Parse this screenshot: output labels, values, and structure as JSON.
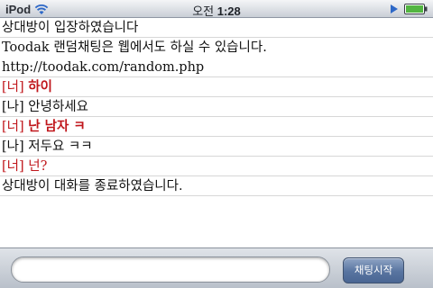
{
  "status_bar": {
    "carrier": "iPod",
    "period": "오전",
    "time": "1:28",
    "icons": [
      "wifi-icon",
      "play-icon",
      "battery-icon"
    ]
  },
  "chat": {
    "lines": [
      {
        "type": "system",
        "text": "상대방이 입장하였습니다"
      },
      {
        "type": "system",
        "text": "Toodak 랜덤채팅은 웹에서도 하실 수 있습니다."
      },
      {
        "type": "system",
        "text": "http://toodak.com/random.php"
      },
      {
        "type": "stranger",
        "prefix": "[너]",
        "text": "하이"
      },
      {
        "type": "me",
        "prefix": "[나]",
        "text": "안녕하세요"
      },
      {
        "type": "stranger",
        "prefix": "[너]",
        "text": "난 남자 ㅋ"
      },
      {
        "type": "me",
        "prefix": "[나]",
        "text": "저두요 ㅋㅋ"
      },
      {
        "type": "stranger",
        "prefix": "[너]",
        "text": "넌?"
      },
      {
        "type": "system",
        "text": "상대방이 대화를 종료하였습니다."
      }
    ]
  },
  "input_bar": {
    "message_value": "",
    "start_button_label": "채팅시작"
  },
  "colors": {
    "stranger_text": "#c0171c",
    "button": "#5874a0"
  }
}
